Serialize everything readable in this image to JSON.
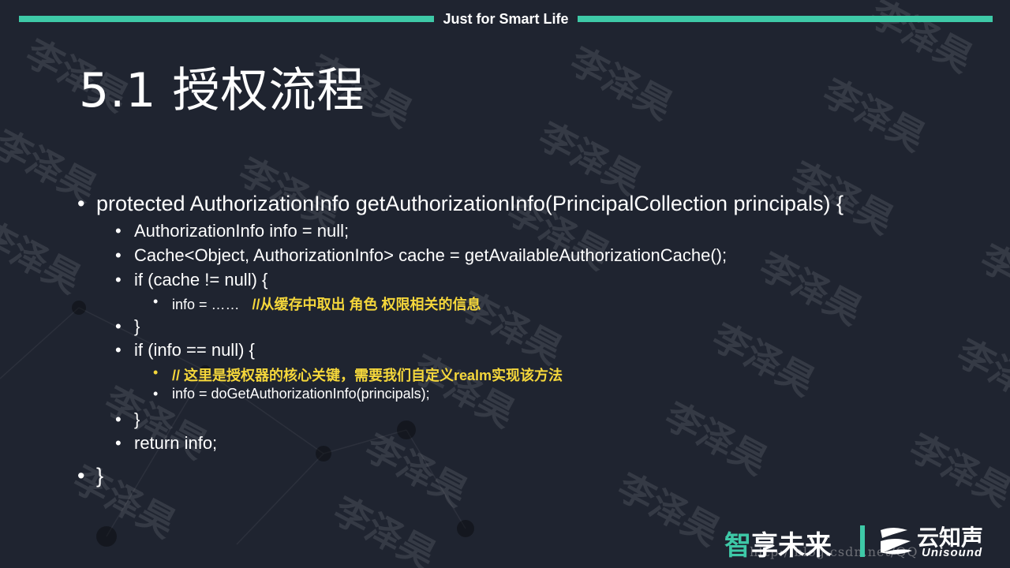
{
  "header": {
    "tagline": "Just for Smart Life"
  },
  "title": "5.1 授权流程",
  "code_lines": [
    {
      "level": 1,
      "text": "protected AuthorizationInfo getAuthorizationInfo(PrincipalCollection principals) {"
    },
    {
      "level": 2,
      "text": "AuthorizationInfo info = null;"
    },
    {
      "level": 2,
      "text": "Cache<Object, AuthorizationInfo> cache = getAvailableAuthorizationCache();"
    },
    {
      "level": 2,
      "text": "if (cache != null) {"
    },
    {
      "level": 3,
      "text": "info = ……",
      "note": "//从缓存中取出 角色 权限相关的信息"
    },
    {
      "level": 2,
      "text": "}"
    },
    {
      "level": 2,
      "text": "if (info == null) {"
    },
    {
      "level": 3,
      "text": "",
      "note": "// 这里是授权器的核心关键，需要我们自定义realm实现该方法"
    },
    {
      "level": 3,
      "text": "info = doGetAuthorizationInfo(principals);"
    },
    {
      "level": 2,
      "text": "}"
    },
    {
      "level": 2,
      "text": "return info;"
    },
    {
      "level": 1,
      "text": "}"
    }
  ],
  "bullet_glyph": "•",
  "watermark_text": "李泽昊",
  "footer": {
    "slogan_first": "智",
    "slogan_rest": "享未来",
    "brand_cn": "云知声",
    "brand_en": "Unisound",
    "url_mark": "http://blog.csdn.net/QQ"
  },
  "colors": {
    "background": "#1f2430",
    "accent": "#3ec9a7",
    "note": "#f5d73b"
  }
}
